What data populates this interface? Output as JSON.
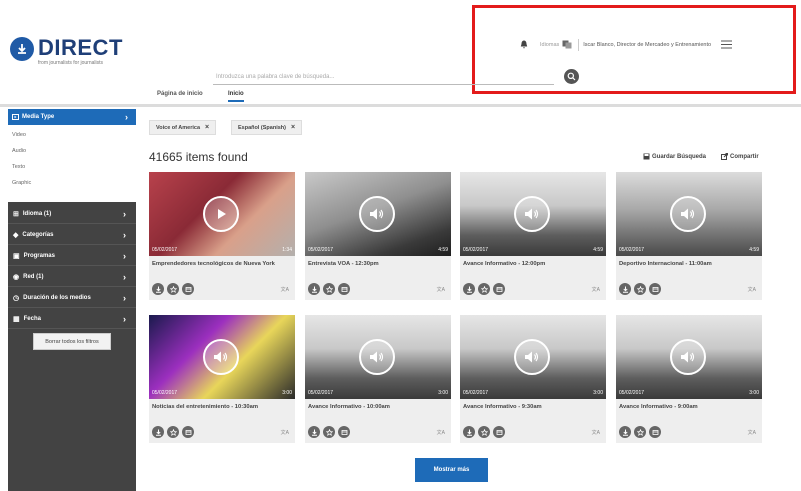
{
  "header": {
    "logo_text": "DIRECT",
    "logo_tagline": "from journalists for journalists",
    "languages_label": "Idiomas",
    "user_name": "Iscar Blanco, Director de Mercadeo y Entrenamiento"
  },
  "search": {
    "placeholder": "Introduzca una palabra clave de búsqueda..."
  },
  "tabs": [
    {
      "label": "Página de inicio"
    },
    {
      "label": "Inicio"
    }
  ],
  "sidebar": {
    "media_type_label": "Media Type",
    "media_options": [
      "Video",
      "Audio",
      "Texto",
      "Graphic"
    ],
    "facets": [
      {
        "label": "Idioma (1)",
        "icon": "translate-icon"
      },
      {
        "label": "Categorías",
        "icon": "tag-icon"
      },
      {
        "label": "Programas",
        "icon": "calendar-icon"
      },
      {
        "label": "Red (1)",
        "icon": "globe-icon"
      },
      {
        "label": "Duración de los medios",
        "icon": "clock-icon"
      },
      {
        "label": "Fecha",
        "icon": "calendar-grid-icon"
      }
    ],
    "clear_label": "Borrar todos los filtros"
  },
  "filters": [
    {
      "label": "Voice of America"
    },
    {
      "label": "Español (Spanish)"
    }
  ],
  "results": {
    "count_text": "41665 items found",
    "save_label": "Guardar Búsqueda",
    "share_label": "Compartir"
  },
  "cards": [
    {
      "date": "05/02/2017",
      "duration": "1:34",
      "title": "Emprendedores tecnológicos de Nueva York",
      "type": "video"
    },
    {
      "date": "05/02/2017",
      "duration": "4:59",
      "title": "Entrevista VOA - 12:30pm",
      "type": "audio"
    },
    {
      "date": "05/02/2017",
      "duration": "4:59",
      "title": "Avance Informativo - 12:00pm",
      "type": "audio"
    },
    {
      "date": "05/02/2017",
      "duration": "4:59",
      "title": "Deportivo Internacional - 11:00am",
      "type": "audio"
    },
    {
      "date": "05/02/2017",
      "duration": "3:00",
      "title": "Noticias del entretenimiento - 10:30am",
      "type": "audio"
    },
    {
      "date": "05/02/2017",
      "duration": "3:00",
      "title": "Avance Informativo - 10:00am",
      "type": "audio"
    },
    {
      "date": "05/02/2017",
      "duration": "3:00",
      "title": "Avance Informativo - 9:30am",
      "type": "audio"
    },
    {
      "date": "05/02/2017",
      "duration": "3:00",
      "title": "Avance Informativo - 9:00am",
      "type": "audio"
    }
  ],
  "show_more_label": "Mostrar más",
  "colors": {
    "brand_blue": "#1e6bb8",
    "sidebar_dark": "#434343",
    "highlight_red": "#e31b1b"
  }
}
